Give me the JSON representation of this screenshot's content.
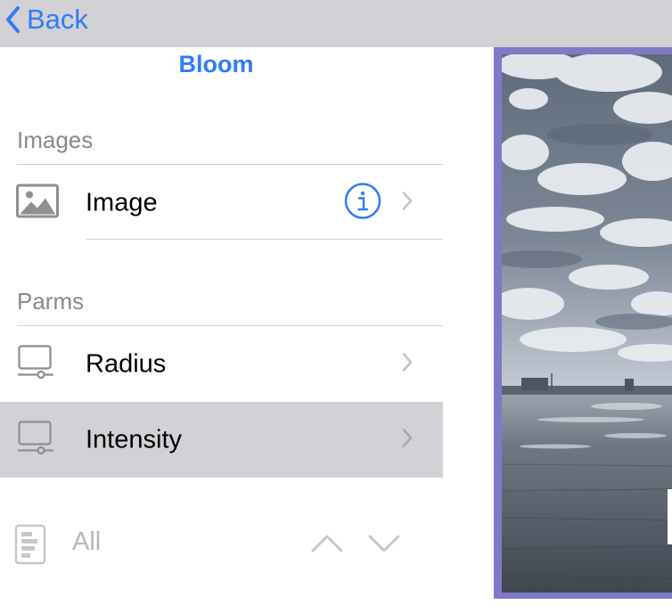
{
  "nav": {
    "back_label": "Back"
  },
  "panel": {
    "title": "Bloom"
  },
  "sections": {
    "images": {
      "header": "Images",
      "items": [
        {
          "label": "Image",
          "icon": "photo-icon"
        }
      ]
    },
    "parms": {
      "header": "Parms",
      "items": [
        {
          "label": "Radius",
          "icon": "monitor-slider-icon"
        },
        {
          "label": "Intensity",
          "icon": "monitor-slider-icon",
          "selected": true
        }
      ]
    }
  },
  "toolbar": {
    "filter_label": "All"
  },
  "colors": {
    "accent": "#2f7cf6",
    "navbar": "#d1d1d6",
    "selected_row": "#d1d1d6",
    "preview_border": "#8079c8"
  }
}
